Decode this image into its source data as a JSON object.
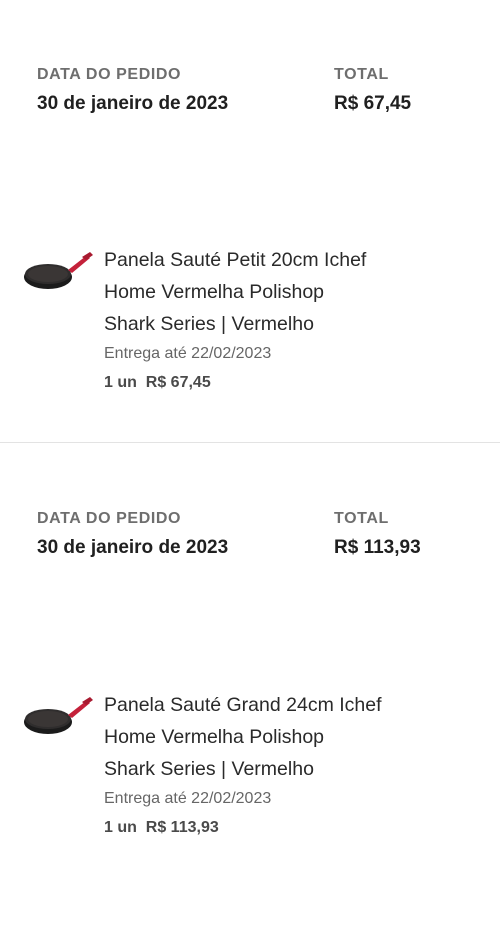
{
  "orders": [
    {
      "date_label": "DATA DO PEDIDO",
      "date_value": "30 de janeiro de 2023",
      "total_label": "TOTAL",
      "total_value": "R$ 67,45",
      "item": {
        "title_line1": "Panela Sauté Petit 20cm Ichef",
        "title_line2": "Home Vermelha Polishop",
        "title_line3": "Shark Series | Vermelho",
        "delivery": "Entrega até 22/02/2023",
        "qty": "1 un",
        "price": "R$ 67,45",
        "image_icon": "frying-pan-icon"
      }
    },
    {
      "date_label": "DATA DO PEDIDO",
      "date_value": "30 de janeiro de 2023",
      "total_label": "TOTAL",
      "total_value": "R$ 113,93",
      "item": {
        "title_line1": "Panela Sauté Grand 24cm Ichef",
        "title_line2": "Home Vermelha Polishop",
        "title_line3": "Shark Series | Vermelho",
        "delivery": "Entrega até 22/02/2023",
        "qty": "1 un",
        "price": "R$ 113,93",
        "image_icon": "frying-pan-icon"
      }
    }
  ],
  "colors": {
    "label": "#6e6e6e",
    "value": "#202020",
    "pan_body": "#2b2b2b",
    "pan_handle": "#c4213a",
    "divider": "#e3e3e3"
  }
}
